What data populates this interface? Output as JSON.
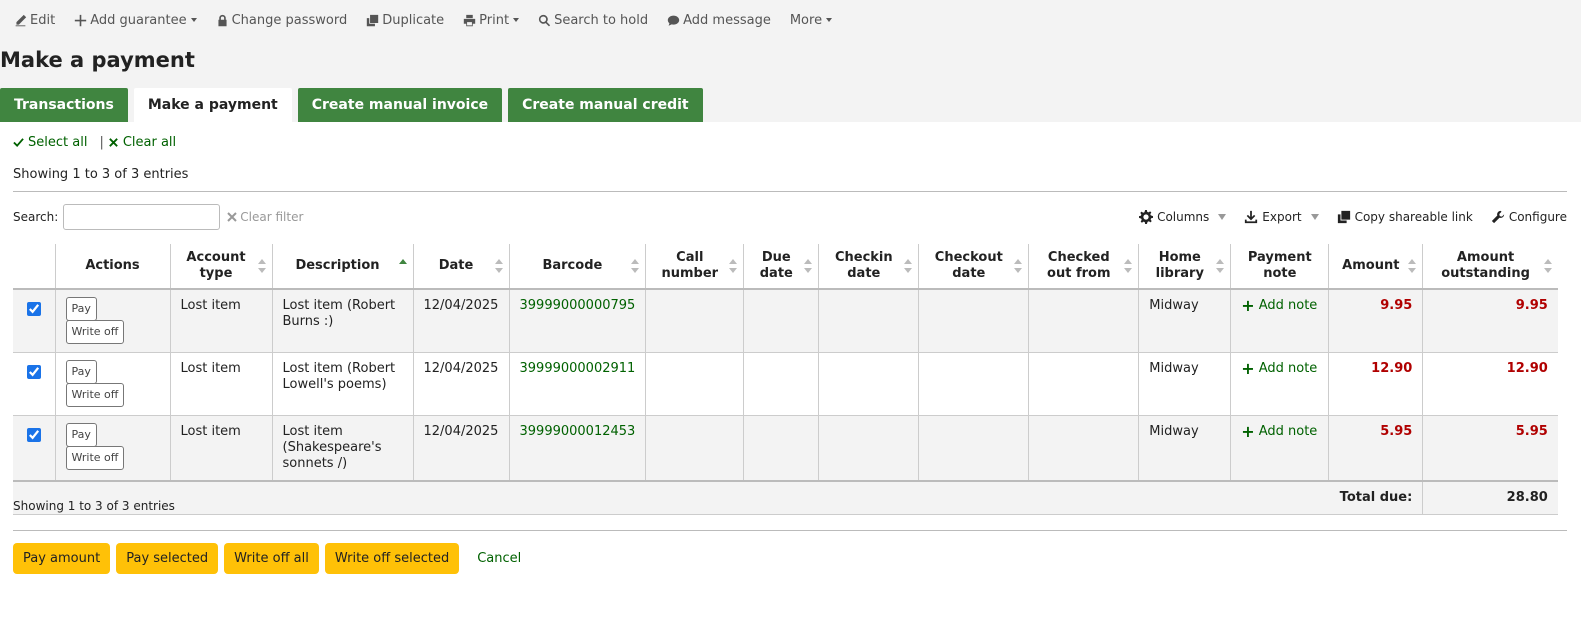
{
  "toolbar": {
    "edit": "Edit",
    "add_guarantee": "Add guarantee",
    "change_password": "Change password",
    "duplicate": "Duplicate",
    "print": "Print",
    "search_to_hold": "Search to hold",
    "add_message": "Add message",
    "more": "More"
  },
  "page_title": "Make a payment",
  "tabs": [
    {
      "label": "Transactions",
      "active": false
    },
    {
      "label": "Make a payment",
      "active": true
    },
    {
      "label": "Create manual invoice",
      "active": false
    },
    {
      "label": "Create manual credit",
      "active": false
    }
  ],
  "select_all": "Select all",
  "clear_all": "Clear all",
  "separator": "|",
  "info_top": "Showing 1 to 3 of 3 entries",
  "info_bottom": "Showing 1 to 3 of 3 entries",
  "search": {
    "label": "Search:",
    "value": "",
    "clear_filter": "Clear filter"
  },
  "table_tools": {
    "columns": "Columns",
    "export": "Export",
    "copy_link": "Copy shareable link",
    "configure": "Configure"
  },
  "columns": [
    {
      "line1": "",
      "line2": ""
    },
    {
      "line1": "Actions",
      "line2": ""
    },
    {
      "line1": "Account",
      "line2": "type"
    },
    {
      "line1": "Description",
      "line2": ""
    },
    {
      "line1": "Date",
      "line2": ""
    },
    {
      "line1": "Barcode",
      "line2": ""
    },
    {
      "line1": "Call",
      "line2": "number"
    },
    {
      "line1": "Due",
      "line2": "date"
    },
    {
      "line1": "Checkin",
      "line2": "date"
    },
    {
      "line1": "Checkout",
      "line2": "date"
    },
    {
      "line1": "Checked",
      "line2": "out from"
    },
    {
      "line1": "Home",
      "line2": "library"
    },
    {
      "line1": "Payment",
      "line2": "note"
    },
    {
      "line1": "Amount",
      "line2": ""
    },
    {
      "line1": "Amount",
      "line2": "outstanding"
    }
  ],
  "row_buttons": {
    "pay": "Pay",
    "write_off": "Write off"
  },
  "rows": [
    {
      "checked": true,
      "account_type": "Lost item",
      "description": "Lost item (Robert Burns :)",
      "date": "12/04/2025",
      "barcode": "39999000000795",
      "call_number": "",
      "due_date": "",
      "checkin_date": "",
      "checkout_date": "",
      "checked_out_from": "",
      "home_library": "Midway",
      "payment_note": "Add note",
      "amount": "9.95",
      "amount_outstanding": "9.95"
    },
    {
      "checked": true,
      "account_type": "Lost item",
      "description": "Lost item (Robert Lowell's poems)",
      "date": "12/04/2025",
      "barcode": "39999000002911",
      "call_number": "",
      "due_date": "",
      "checkin_date": "",
      "checkout_date": "",
      "checked_out_from": "",
      "home_library": "Midway",
      "payment_note": "Add note",
      "amount": "12.90",
      "amount_outstanding": "12.90"
    },
    {
      "checked": true,
      "account_type": "Lost item",
      "description": "Lost item (Shakespeare's sonnets /)",
      "date": "12/04/2025",
      "barcode": "39999000012453",
      "call_number": "",
      "due_date": "",
      "checkin_date": "",
      "checkout_date": "",
      "checked_out_from": "",
      "home_library": "Midway",
      "payment_note": "Add note",
      "amount": "5.95",
      "amount_outstanding": "5.95"
    }
  ],
  "total": {
    "label": "Total due:",
    "value": "28.80"
  },
  "buttons": {
    "pay_amount": "Pay amount",
    "pay_selected": "Pay selected",
    "write_off_all": "Write off all",
    "write_off_selected": "Write off selected",
    "cancel": "Cancel"
  },
  "colors": {
    "green": "#408540",
    "link_green": "#006100",
    "amount_red": "#b00000",
    "yellow": "#ffc107"
  }
}
